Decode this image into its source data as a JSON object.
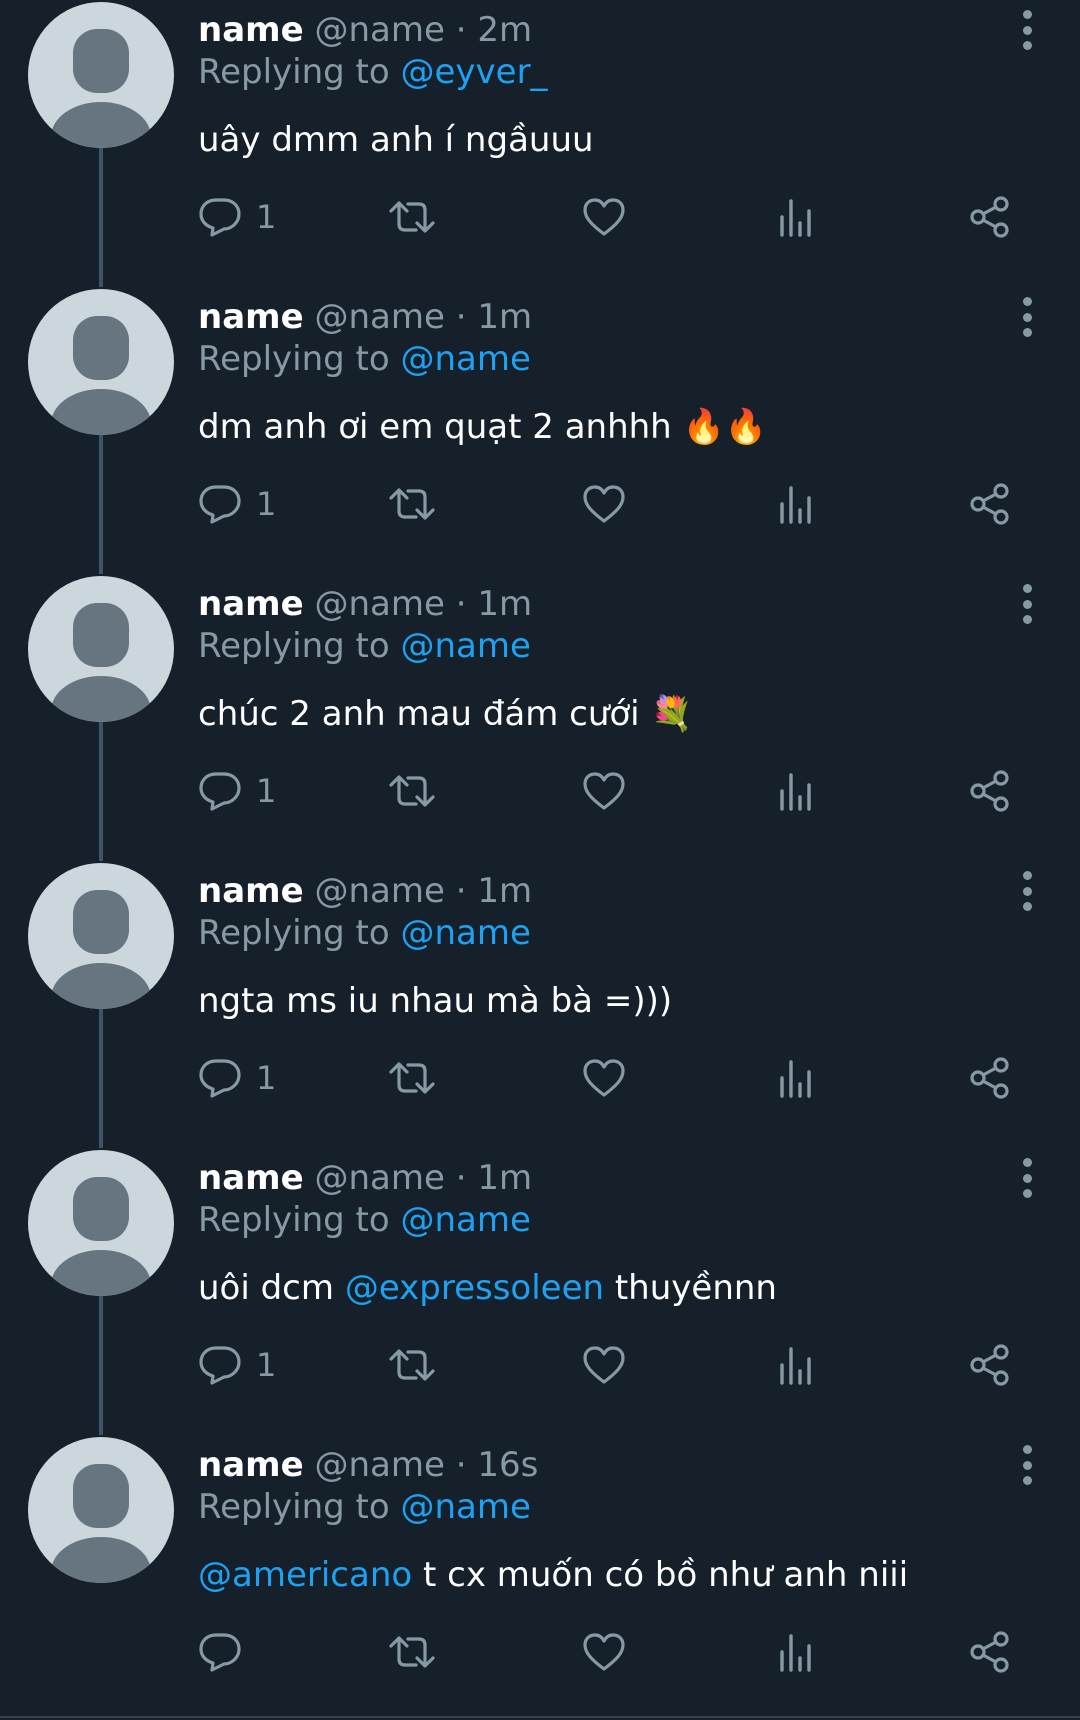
{
  "colors": {
    "background": "#15202b",
    "secondary_text": "#8899a6",
    "mention": "#1da1f2",
    "avatar_bg": "#ccd6dd",
    "avatar_fg": "#66757f"
  },
  "icons": {
    "reply": "speech-bubble-icon",
    "retweet": "retweet-arrows-icon",
    "like": "heart-icon",
    "views": "bar-chart-icon",
    "share": "share-nodes-icon",
    "more": "vertical-ellipsis-icon"
  },
  "tweets": [
    {
      "name": "name",
      "handle": "@name",
      "separator": "·",
      "time": "2m",
      "replying_label": "Replying to",
      "replying_to": "@eyver_",
      "text_before": "uây dmm anh í ngầuuu",
      "text_mention": "",
      "text_after": "",
      "emoji": "",
      "reply_count": "1"
    },
    {
      "name": "name",
      "handle": "@name",
      "separator": "·",
      "time": "1m",
      "replying_label": "Replying to",
      "replying_to": "@name",
      "text_before": "dm anh ơi em quạt 2 anhhh ",
      "text_mention": "",
      "text_after": "",
      "emoji": "🔥🔥",
      "reply_count": "1"
    },
    {
      "name": "name",
      "handle": "@name",
      "separator": "·",
      "time": "1m",
      "replying_label": "Replying to",
      "replying_to": "@name",
      "text_before": "chúc 2 anh mau đám cưới ",
      "text_mention": "",
      "text_after": "",
      "emoji": "💐",
      "reply_count": "1"
    },
    {
      "name": "name",
      "handle": "@name",
      "separator": "·",
      "time": "1m",
      "replying_label": "Replying to",
      "replying_to": "@name",
      "text_before": "ngta ms iu nhau mà bà =)))",
      "text_mention": "",
      "text_after": "",
      "emoji": "",
      "reply_count": "1"
    },
    {
      "name": "name",
      "handle": "@name",
      "separator": "·",
      "time": "1m",
      "replying_label": "Replying to",
      "replying_to": "@name",
      "text_before": "uôi dcm ",
      "text_mention": "@expressoleen",
      "text_after": " thuyềnnn",
      "emoji": "",
      "reply_count": "1"
    },
    {
      "name": "name",
      "handle": "@name",
      "separator": "·",
      "time": "16s",
      "replying_label": "Replying to",
      "replying_to": "@name",
      "text_before": "",
      "text_mention": "@americano",
      "text_after": " t cx muốn có bồ như anh niii",
      "emoji": "",
      "reply_count": ""
    }
  ]
}
